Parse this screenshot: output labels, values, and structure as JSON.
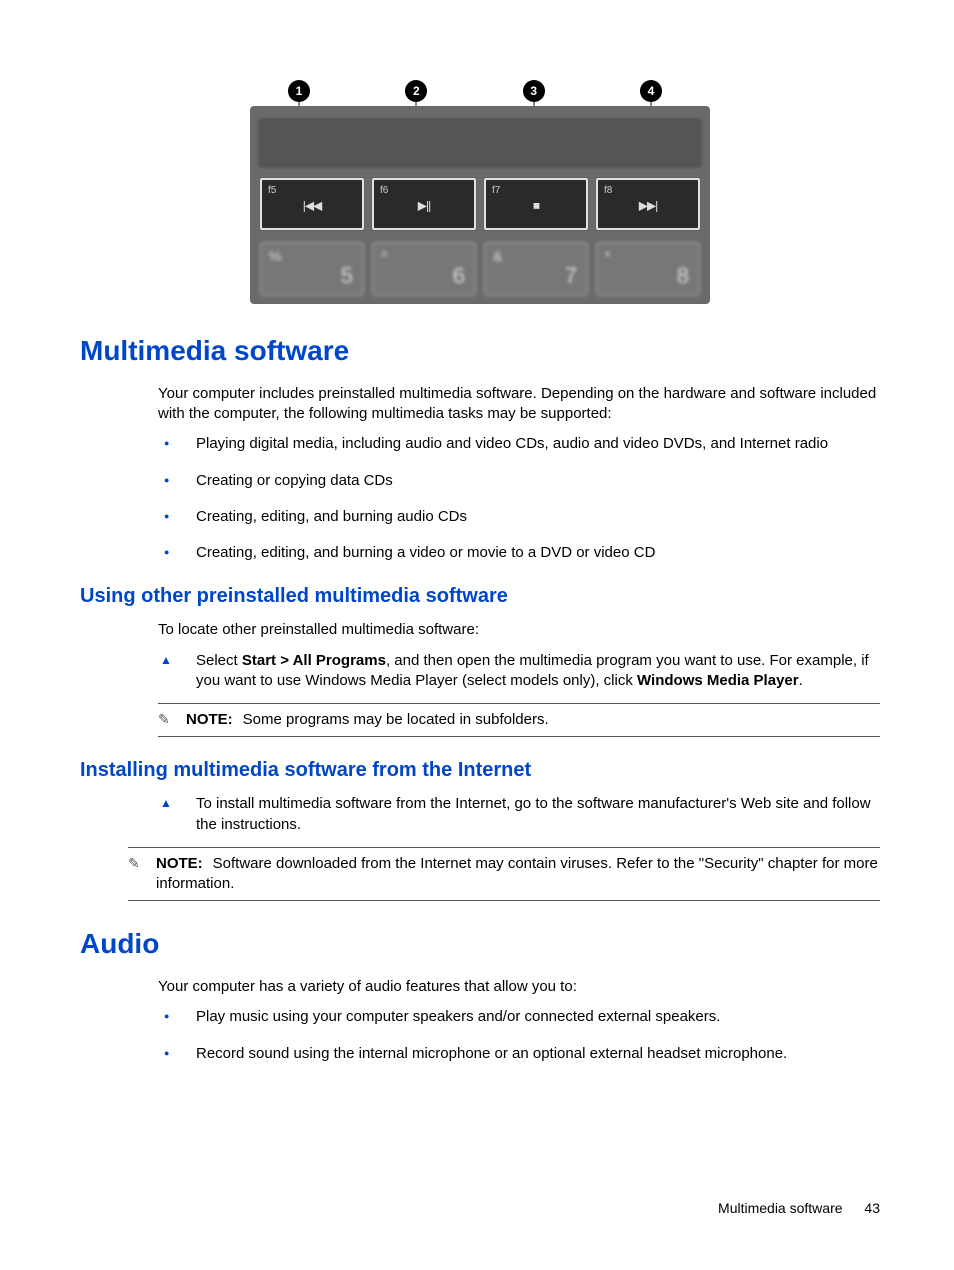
{
  "figure": {
    "callouts": [
      "1",
      "2",
      "3",
      "4"
    ],
    "fn_keys": [
      {
        "label": "f5",
        "icon": "|◀◀"
      },
      {
        "label": "f6",
        "icon": "▶||"
      },
      {
        "label": "f7",
        "icon": "■"
      },
      {
        "label": "f8",
        "icon": "▶▶|"
      }
    ],
    "num_keys": [
      {
        "sym": "%",
        "dig": "5"
      },
      {
        "sym": "^",
        "dig": "6"
      },
      {
        "sym": "&",
        "dig": "7"
      },
      {
        "sym": "*",
        "dig": "8"
      }
    ]
  },
  "s1": {
    "title": "Multimedia software",
    "intro": "Your computer includes preinstalled multimedia software. Depending on the hardware and software included with the computer, the following multimedia tasks may be supported:",
    "bullets": [
      "Playing digital media, including audio and video CDs, audio and video DVDs, and Internet radio",
      "Creating or copying data CDs",
      "Creating, editing, and burning audio CDs",
      "Creating, editing, and burning a video or movie to a DVD or video CD"
    ]
  },
  "s2": {
    "title": "Using other preinstalled multimedia software",
    "intro": "To locate other preinstalled multimedia software:",
    "step_pre": "Select ",
    "step_b1": "Start > All Programs",
    "step_mid": ", and then open the multimedia program you want to use. For example, if you want to use Windows Media Player (select models only), click ",
    "step_b2": "Windows Media Player",
    "step_post": ".",
    "note_label": "NOTE:",
    "note_text": "Some programs may be located in subfolders."
  },
  "s3": {
    "title": "Installing multimedia software from the Internet",
    "step": "To install multimedia software from the Internet, go to the software manufacturer's Web site and follow the instructions.",
    "note_label": "NOTE:",
    "note_text": "Software downloaded from the Internet may contain viruses. Refer to the \"Security\" chapter for more information."
  },
  "s4": {
    "title": "Audio",
    "intro": "Your computer has a variety of audio features that allow you to:",
    "bullets": [
      "Play music using your computer speakers and/or connected external speakers.",
      "Record sound using the internal microphone or an optional external headset microphone."
    ]
  },
  "footer": {
    "text": "Multimedia software",
    "page": "43"
  }
}
